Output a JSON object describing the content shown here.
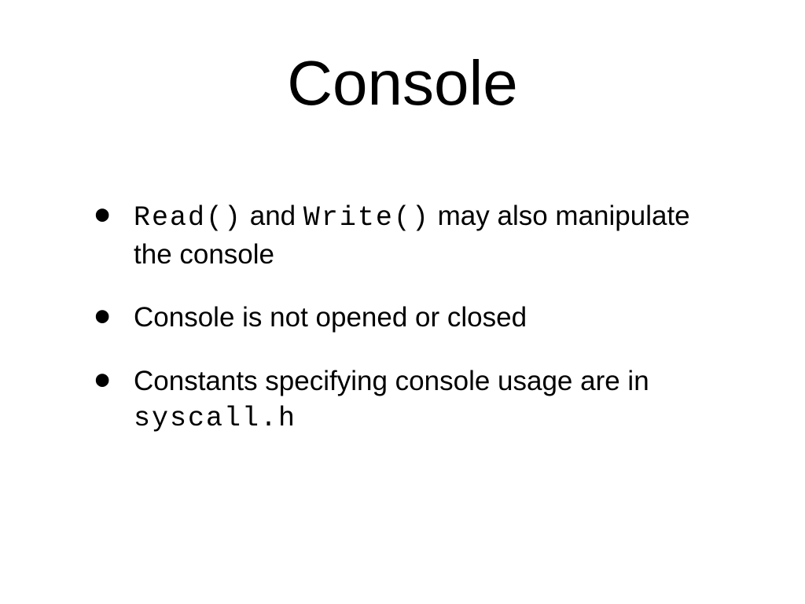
{
  "slide": {
    "title": "Console",
    "bullets": [
      {
        "parts": [
          {
            "text": "Read()",
            "mono": true
          },
          {
            "text": " and ",
            "mono": false
          },
          {
            "text": "Write()",
            "mono": true
          },
          {
            "text": " may also manipulate the console",
            "mono": false
          }
        ]
      },
      {
        "parts": [
          {
            "text": "Console is not opened or closed",
            "mono": false
          }
        ]
      },
      {
        "parts": [
          {
            "text": "Constants specifying console usage are in ",
            "mono": false
          },
          {
            "text": "syscall.h",
            "mono": true
          }
        ]
      }
    ]
  }
}
